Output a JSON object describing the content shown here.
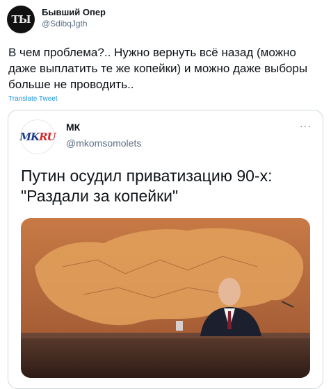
{
  "tweet": {
    "author_name": "Бывший Опер",
    "author_handle": "@SdibqJgth",
    "avatar_text": "ТЫ",
    "text": "В чем проблема?.. Нужно вернуть всё назад (можно даже выплатить те же копейки) и можно даже выборы больше не проводить..",
    "translate_label": "Translate Tweet"
  },
  "quote": {
    "author_name": "МК",
    "author_handle": "@mkomsomolets",
    "logo_part1": "MK",
    "logo_part2": "RU",
    "more_label": "···",
    "headline": "Путин осудил приватизацию 90-х: \"Раздали за копейки\"",
    "media_icon": "photo-map-press-conference"
  },
  "colors": {
    "link": "#1b95e0",
    "secondary_text": "#5b7083",
    "border": "#cfd9de",
    "map_bg": "#b86a3c",
    "map_land": "#e3a15c"
  }
}
